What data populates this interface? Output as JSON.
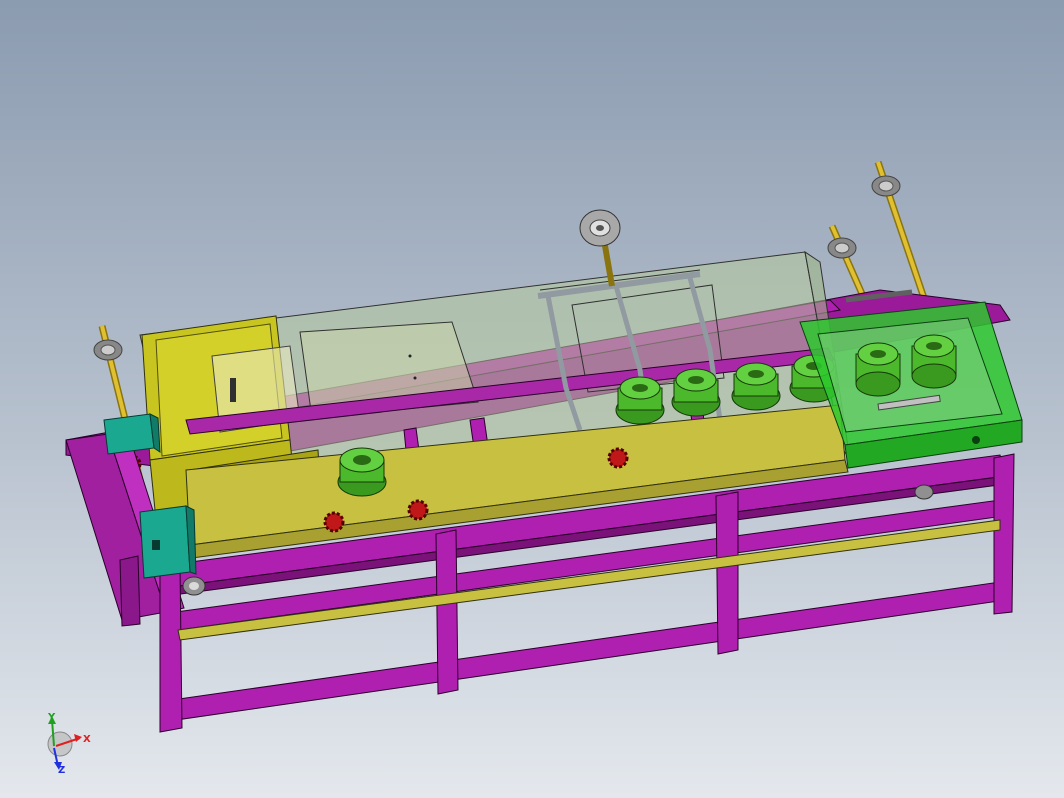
{
  "viewport": {
    "background_top": "#8b9bb0",
    "background_bottom": "#e4e8ed"
  },
  "colors": {
    "frame": "#b020b0",
    "frame_dark": "#6a106a",
    "tray": "#c8c040",
    "cabinet": "#c9c520",
    "glass": "#b5c89a",
    "roller": "#4cb82c",
    "end_box": "#2ec82e",
    "teal_block": "#1aa890",
    "shaft": "#d8b820",
    "sprocket": "#c01818",
    "motor": "#a8a8a8"
  },
  "triad": {
    "x_label": "X",
    "y_label": "Y",
    "z_label": "Z",
    "x_color": "#e02020",
    "y_color": "#20a020",
    "z_color": "#2030e0"
  }
}
